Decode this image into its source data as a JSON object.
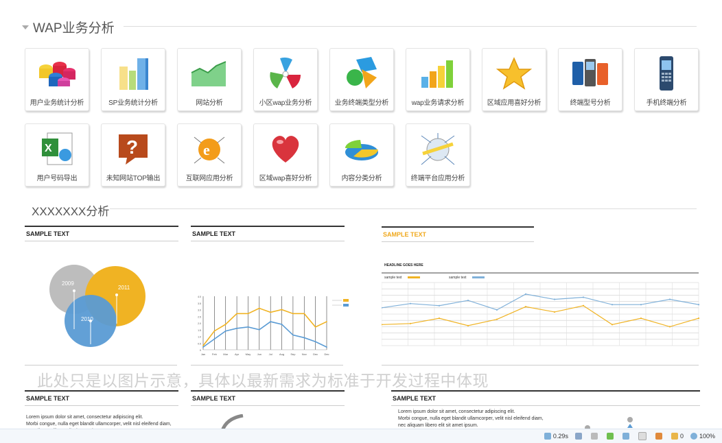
{
  "sections": {
    "wap_title": "WAP业务分析",
    "second_title": "XXXXXXX分析"
  },
  "tiles": [
    {
      "label": "用户业务统计分析",
      "icon": "cylinders-icon"
    },
    {
      "label": "SP业务统计分析",
      "icon": "bar-3d-icon"
    },
    {
      "label": "网站分析",
      "icon": "area-3d-icon"
    },
    {
      "label": "小区wap业务分析",
      "icon": "pie-segments-icon"
    },
    {
      "label": "业务终端类型分析",
      "icon": "shapes-icon"
    },
    {
      "label": "wap业务请求分析",
      "icon": "bars-color-icon"
    },
    {
      "label": "区域应用喜好分析",
      "icon": "star-icon"
    },
    {
      "label": "终端型号分析",
      "icon": "phones-icon"
    },
    {
      "label": "手机终端分析",
      "icon": "mobile-icon"
    },
    {
      "label": "用户号码导出",
      "icon": "excel-icon"
    },
    {
      "label": "未知网站TOP输出",
      "icon": "question-icon"
    },
    {
      "label": "互联网应用分析",
      "icon": "ie-globe-icon"
    },
    {
      "label": "区域wap喜好分析",
      "icon": "heart-icon"
    },
    {
      "label": "内容分类分析",
      "icon": "pie-3d-icon"
    },
    {
      "label": "终端平台应用分析",
      "icon": "network-globe-icon"
    }
  ],
  "panels": {
    "p1": "SAMPLE TEXT",
    "p2": "SAMPLE TEXT",
    "p3": "SAMPLE TEXT",
    "p4": "SAMPLE TEXT",
    "p5": "SAMPLE TEXT",
    "p6": "SAMPLE TEXT"
  },
  "venn": {
    "labels": [
      "2009",
      "2011",
      "2010"
    ]
  },
  "watermark": "此处只是以图片示意，具体以最新需求为标准于开发过程中体现",
  "ipsum": [
    "Lorem ipsum dolor sit amet, consectetur adipiscing elit.",
    "Morbi congue, nulla eget blandit ullamcorper, velit nisl eleifend diam,",
    "nec aliquam libero elit sit amet ipsum."
  ],
  "chart_data": [
    {
      "type": "line",
      "categories": [
        "Jan",
        "Feb",
        "Mar",
        "Apr",
        "May",
        "Jun",
        "Jul",
        "Aug",
        "Sep",
        "Nov",
        "Dec",
        "Dec"
      ],
      "ylim": [
        0,
        4
      ],
      "yticks": [
        "0",
        "0.5",
        "1.0",
        "1.5",
        "2.0",
        "2.5",
        "3.0",
        "3.5",
        "4.0"
      ],
      "series": [
        {
          "name": "Series 1",
          "color": "#f0b323",
          "values": [
            0.3,
            1.4,
            1.9,
            2.7,
            2.7,
            3.1,
            2.8,
            3.0,
            2.7,
            2.7,
            1.7,
            2.1
          ]
        },
        {
          "name": "Series 2",
          "color": "#5a9bd4",
          "values": [
            0.2,
            0.8,
            1.4,
            1.6,
            1.7,
            1.5,
            2.1,
            1.9,
            1.1,
            0.9,
            0.6,
            0.2
          ]
        }
      ]
    },
    {
      "type": "line",
      "title": "HEADLINE GOES HERE",
      "series": [
        {
          "name": "sample text",
          "color": "#f0b323",
          "values": [
            2.0,
            2.1,
            2.6,
            1.9,
            2.5,
            3.7,
            3.2,
            3.8,
            2.0,
            2.6,
            1.8,
            2.6
          ]
        },
        {
          "name": "sample text",
          "color": "#7fb0d9",
          "values": [
            3.6,
            4.0,
            3.8,
            4.3,
            3.4,
            4.9,
            4.4,
            4.6,
            3.9,
            3.9,
            4.4,
            3.9
          ]
        }
      ],
      "ylim": [
        0,
        6
      ]
    }
  ],
  "status": {
    "time": "0.29s",
    "count": "0",
    "zoom": "100%"
  }
}
